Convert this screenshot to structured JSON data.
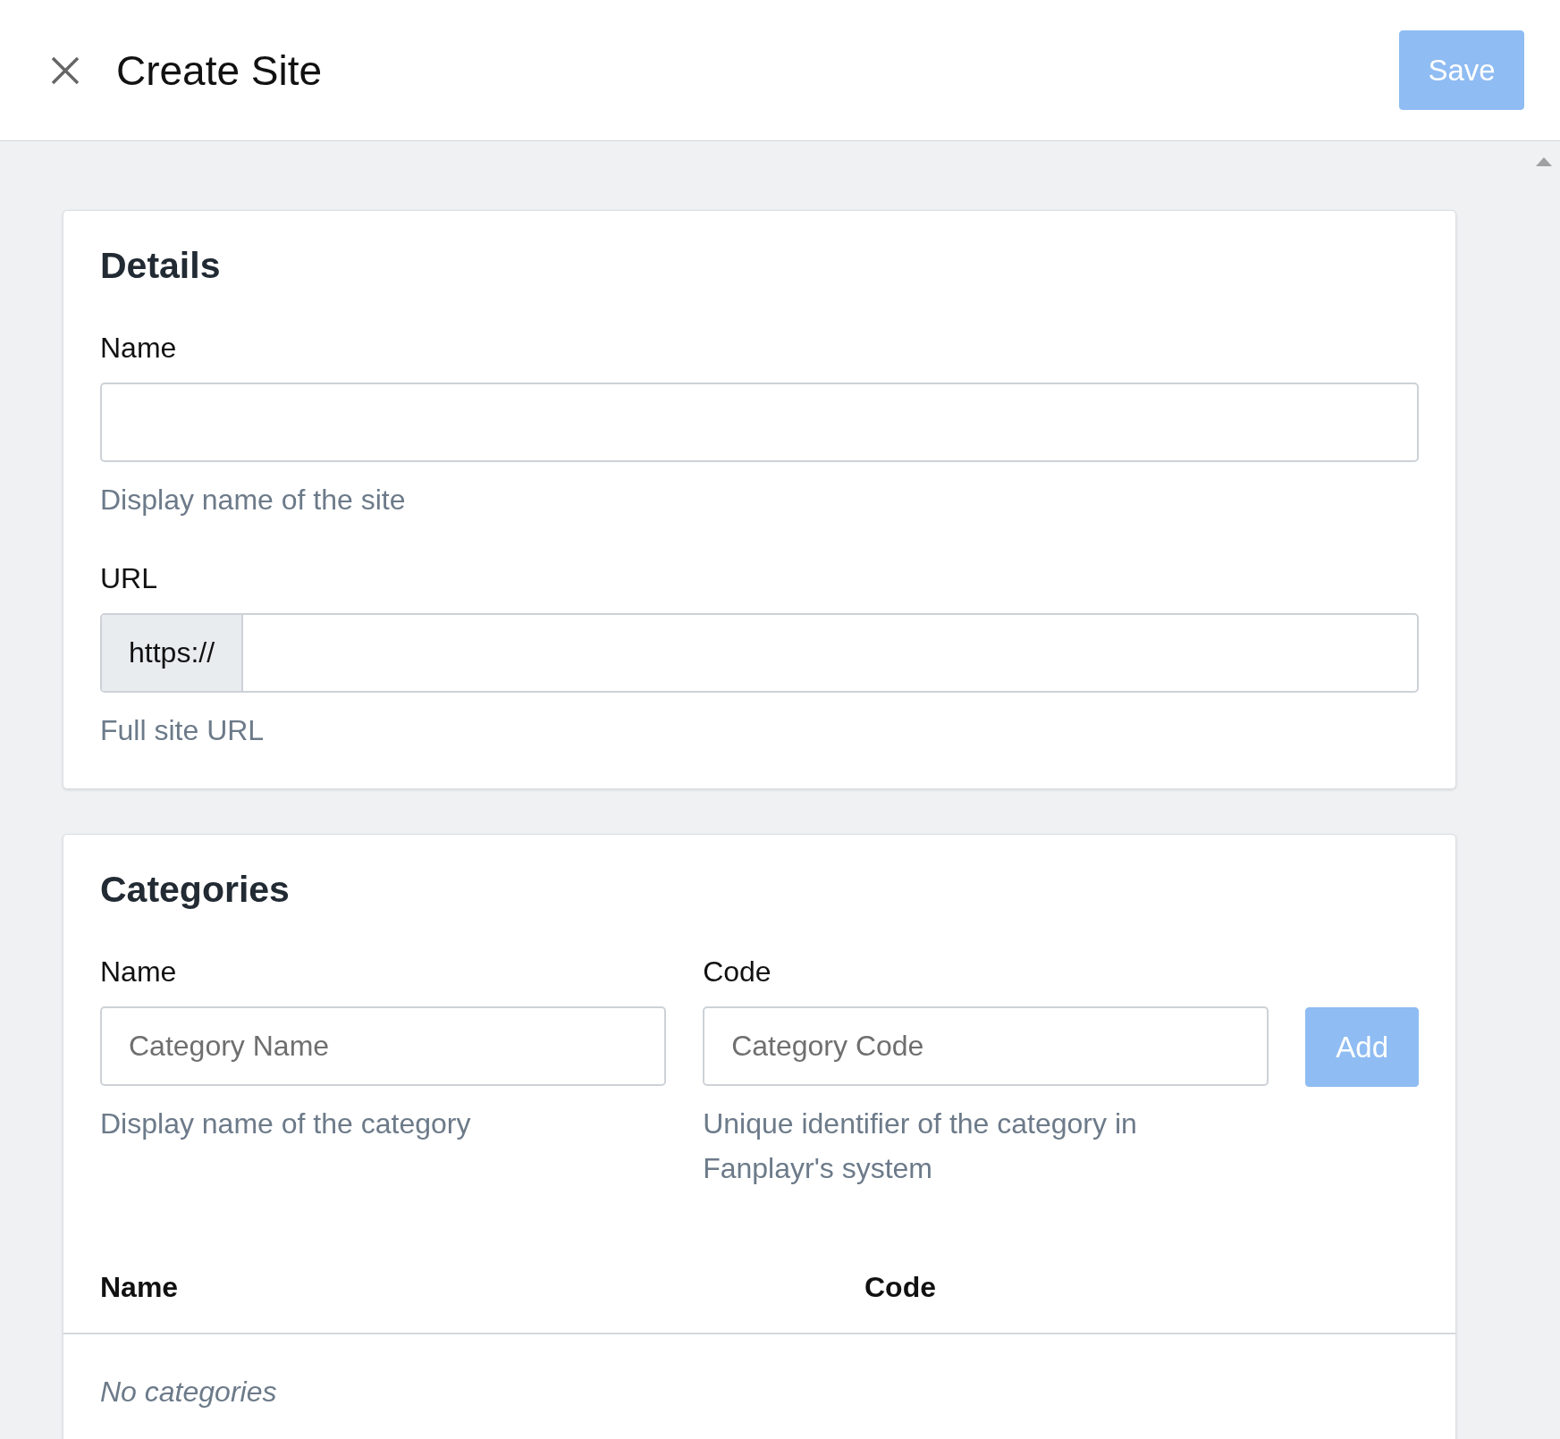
{
  "header": {
    "title": "Create Site",
    "save_button": {
      "label": "Save",
      "disabled": true
    }
  },
  "details": {
    "heading": "Details",
    "fields": [
      {
        "kind": "text",
        "label": "Name",
        "help": "Display name of the site"
      },
      {
        "kind": "prefixed",
        "label": "URL",
        "prefix": "https://",
        "help": "Full site URL"
      }
    ]
  },
  "categories": {
    "heading": "Categories",
    "fields": [
      {
        "label": "Name",
        "placeholder": "Category Name",
        "help": "Display name of the category"
      },
      {
        "label": "Code",
        "placeholder": "Category Code",
        "help": "Unique identifier of the category in Fanplayr's system"
      }
    ],
    "add_button": {
      "label": "Add",
      "disabled": true
    },
    "table": {
      "columns": [
        "Name",
        "Code"
      ],
      "empty_text": "No categories"
    }
  }
}
